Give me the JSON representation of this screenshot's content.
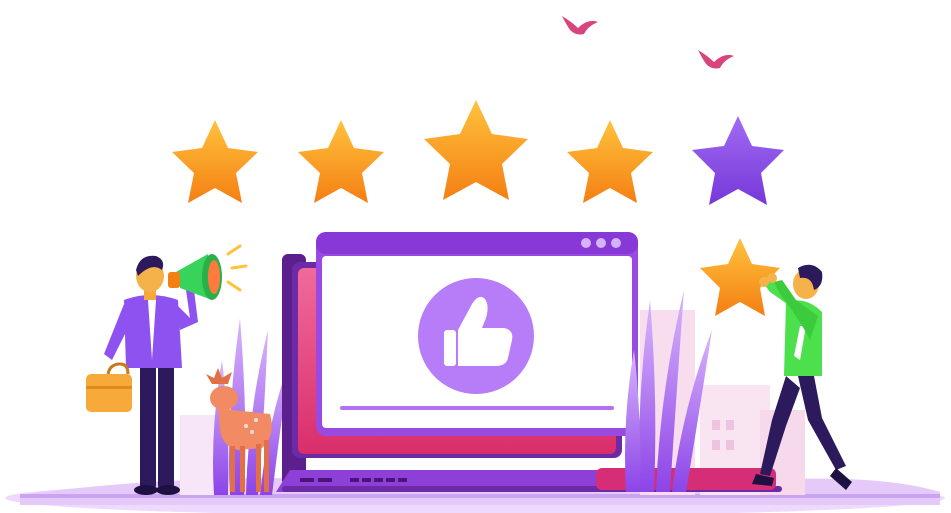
{
  "illustration": {
    "rating": {
      "filled": 4,
      "total": 5
    },
    "colors": {
      "star_gold": "#FFA21F",
      "star_gold_dark": "#F47F13",
      "star_purple": "#8A4BE8",
      "window_frame": "#9A4AE0",
      "window_accent": "#B571F4",
      "pink_panel": "#E9457D",
      "thumb_badge": "#B77CF7",
      "ground": "#E4C9F9",
      "man_shirt": "#8E52F0",
      "man_trousers": "#2D1A5C",
      "woman_shirt": "#4DE04D",
      "megaphone": "#38D35B",
      "briefcase": "#F7A93A",
      "deer": "#F28A63",
      "bird": "#D8457E",
      "grass": "#A765F0"
    },
    "icons": [
      "star-icon",
      "thumbs-up-icon",
      "megaphone-icon",
      "briefcase-icon",
      "bird-icon",
      "deer-icon",
      "keyboard-icon"
    ]
  }
}
